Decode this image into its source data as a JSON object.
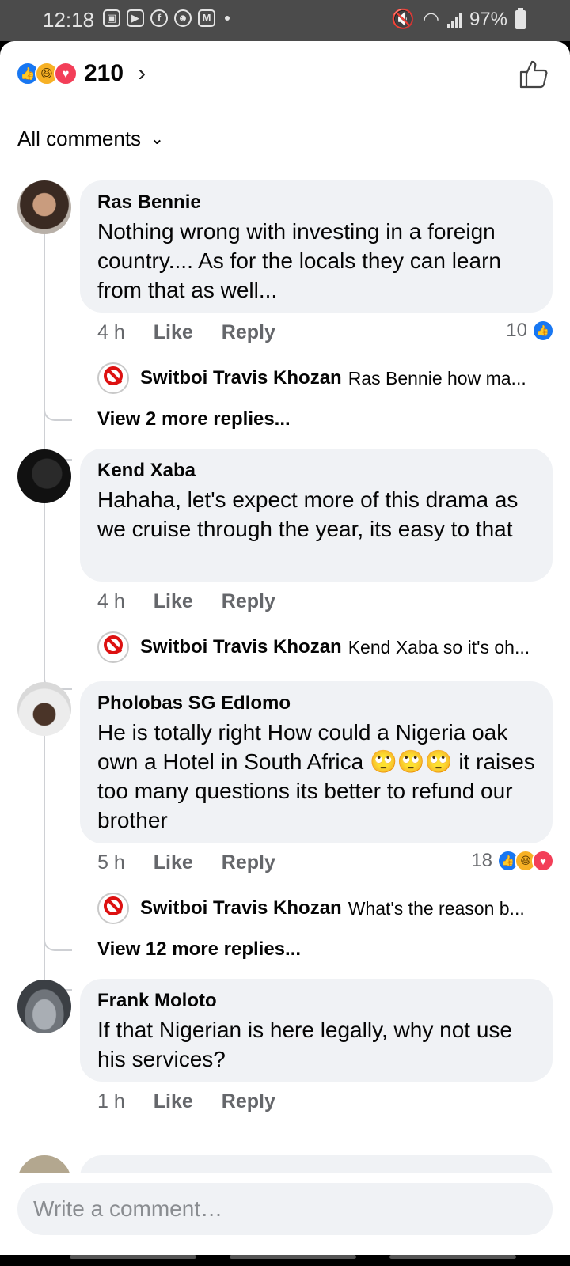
{
  "status_bar": {
    "time": "12:18",
    "battery": "97%",
    "notification_icons": [
      "gallery-icon",
      "youtube-icon",
      "facebook-icon",
      "android-icon",
      "gmail-icon"
    ]
  },
  "reactions": {
    "count": "210",
    "types": [
      "like",
      "haha",
      "love"
    ]
  },
  "filter": {
    "label": "All comments"
  },
  "comments": [
    {
      "author": "Ras Bennie",
      "text": "Nothing wrong with investing in a foreign country.... As for the locals they can learn from that as well...",
      "time": "4 h",
      "like_label": "Like",
      "reply_label": "Reply",
      "reaction_count": "10",
      "reply": {
        "author": "Switboi Travis Khozan",
        "text": "Ras Bennie how ma..."
      },
      "more_replies": "View 2 more replies..."
    },
    {
      "author": "Kend Xaba",
      "text": "Hahaha, let's expect more of this drama as we cruise through the year, its easy to that",
      "time": "4 h",
      "like_label": "Like",
      "reply_label": "Reply",
      "reply": {
        "author": "Switboi Travis Khozan",
        "text": "Kend Xaba so it's oh..."
      }
    },
    {
      "author": "Pholobas SG Edlomo",
      "text": "He is totally right How could a Nigeria oak own a Hotel in South Africa 🙄🙄🙄 it raises too many questions its better to refund our brother",
      "time": "5 h",
      "like_label": "Like",
      "reply_label": "Reply",
      "reaction_count": "18",
      "reply": {
        "author": "Switboi Travis Khozan",
        "text": "What's the reason b..."
      },
      "more_replies": "View 12 more replies..."
    },
    {
      "author": "Frank Moloto",
      "text": "If that Nigerian is here legally, why not use his services?",
      "time": "1 h",
      "like_label": "Like",
      "reply_label": "Reply"
    }
  ],
  "composer": {
    "placeholder": "Write a comment…"
  }
}
